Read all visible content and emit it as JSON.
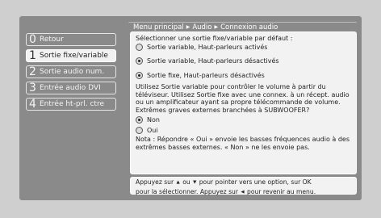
{
  "breadcrumb": {
    "items": [
      "Menu principal",
      "Audio",
      "Connexion audio"
    ],
    "separator": "▶"
  },
  "sidebar": {
    "items": [
      {
        "num": "0",
        "label": "Retour",
        "active": false
      },
      {
        "num": "1",
        "label": "Sortie fixe/variable",
        "active": true
      },
      {
        "num": "2",
        "label": "Sortie audio num.",
        "active": false
      },
      {
        "num": "3",
        "label": "Entrée audio DVI",
        "active": false
      },
      {
        "num": "4",
        "label": "Entrée ht-prl. ctre",
        "active": false
      }
    ]
  },
  "content": {
    "prompt": "Sélectionner une sortie fixe/variable par défaut :",
    "options": [
      {
        "label": "Sortie variable, Haut-parleurs activés",
        "selected": false
      },
      {
        "label": "Sortie variable, Haut-parleurs désactivés",
        "selected": true
      },
      {
        "label": "Sortie fixe, Haut-parleurs désactivés",
        "selected": true
      }
    ],
    "info": "Utilisez Sortie variable pour contrôler le volume à partir du téléviseur. Utilisez Sortie fixe avec une connex. à un récept. audio ou un amplificateur ayant sa propre télécommande de volume.",
    "question": "Extrêmes graves externes branchées à SUBWOOFER?",
    "answers": [
      {
        "label": "Non",
        "selected": true
      },
      {
        "label": "Oui",
        "selected": false
      }
    ],
    "note": "Nota : Répondre « Oui » envoie les basses fréquences audio à des extrêmes basses externes. « Non » ne les envoie pas."
  },
  "help": {
    "line1_a": "Appuyez sur",
    "up_glyph": "▲",
    "or": "ou",
    "down_glyph": "▼",
    "line1_b": "pour pointer vers une option, sur OK",
    "line2_a": "pour la sélectionner. Appuyez sur",
    "left_glyph": "◀",
    "line2_b": "pour revenir au menu."
  },
  "colors": {
    "frame": "#8a8a8a",
    "panel": "#f2f2f2",
    "background": "#cfcfcf"
  }
}
